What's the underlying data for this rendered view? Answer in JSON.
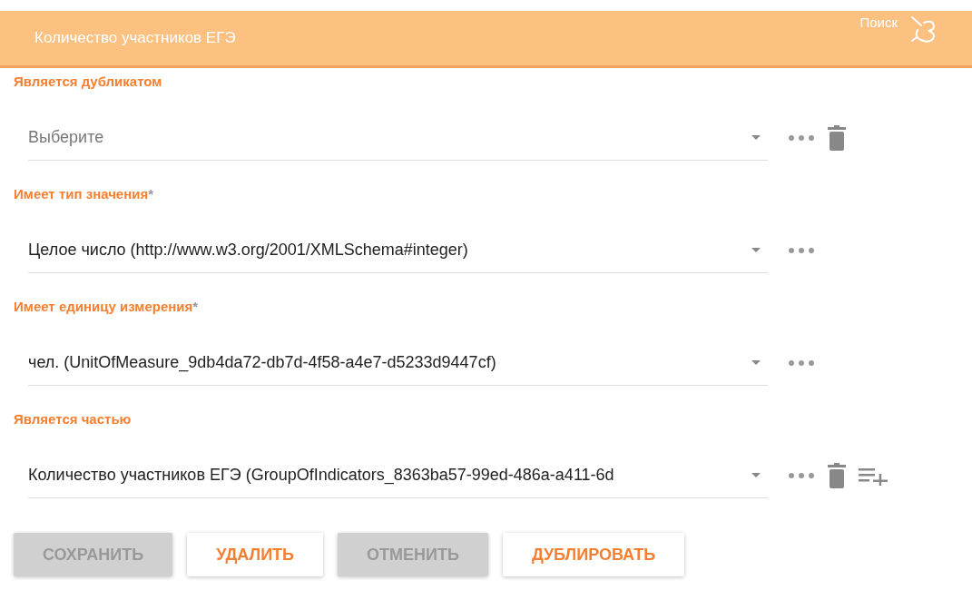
{
  "header": {
    "title": "Количество участников ЕГЭ",
    "search_label": "Поиск"
  },
  "fields": [
    {
      "label": "Является дубликатом",
      "placeholder": "Выберите",
      "deletable": true,
      "addable": false
    },
    {
      "label": "Имеет тип значения",
      "required_mark": "*",
      "value": "Целое число (http://www.w3.org/2001/XMLSchema#integer)",
      "deletable": false,
      "addable": false
    },
    {
      "label": "Имеет единицу измерения",
      "required_mark": "*",
      "value": "чел. (UnitOfMeasure_9db4da72-db7d-4f58-a4e7-d5233d9447cf)",
      "deletable": false,
      "addable": false
    },
    {
      "label": "Является частью",
      "value": "Количество участников ЕГЭ (GroupOfIndicators_8363ba57-99ed-486a-a411-6d",
      "deletable": true,
      "addable": true
    }
  ],
  "buttons": [
    {
      "label": "СОХРАНИТЬ",
      "disabled": true
    },
    {
      "label": "УДАЛИТЬ",
      "disabled": false
    },
    {
      "label": "ОТМЕНИТЬ",
      "disabled": true
    },
    {
      "label": "ДУБЛИРОВАТЬ",
      "disabled": false
    }
  ]
}
